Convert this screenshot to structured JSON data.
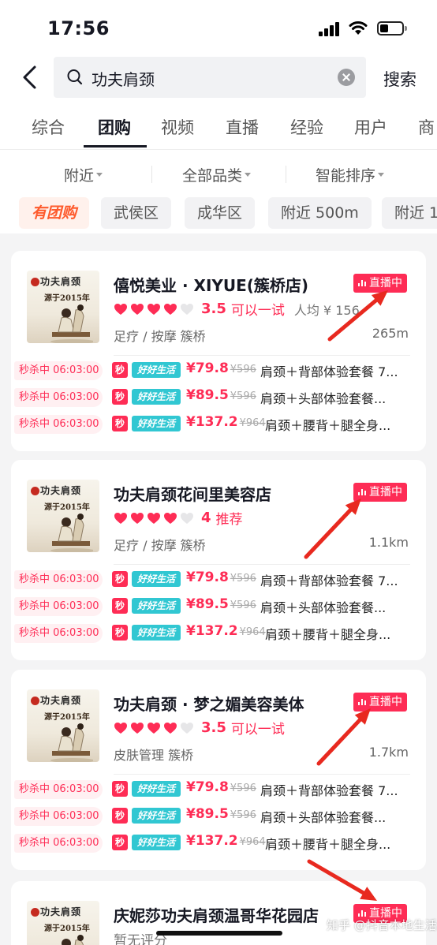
{
  "status": {
    "time": "17:56"
  },
  "search": {
    "query": "功夫肩颈",
    "button": "搜索"
  },
  "tabs": [
    "综合",
    "团购",
    "视频",
    "直播",
    "经验",
    "用户",
    "商"
  ],
  "filters": [
    "附近",
    "全部品类",
    "智能排序"
  ],
  "chips": [
    "有团购",
    "武侯区",
    "成华区",
    "附近 500m",
    "附近 1"
  ],
  "thumb": {
    "brand": "功夫肩颈",
    "since": "源于2015年"
  },
  "live_label": "直播中",
  "shops": [
    {
      "name": "僖悦美业 · XIYUE(簇桥店)",
      "hearts": 4,
      "score": "3.5",
      "verdict": "可以一试",
      "avg": "人均 ¥ 156",
      "category": "足疗 / 按摩   簇桥",
      "distance": "265m",
      "deals": [
        {
          "flash": "秒杀中 06:03:00",
          "sec": "秒",
          "tag": "好好生活",
          "price": "¥79.8",
          "orig": "¥596",
          "name": "肩颈＋背部体验套餐 7..."
        },
        {
          "flash": "秒杀中 06:03:00",
          "sec": "秒",
          "tag": "好好生活",
          "price": "¥89.5",
          "orig": "¥596",
          "name": "肩颈＋头部体验套餐..."
        },
        {
          "flash": "秒杀中 06:03:00",
          "sec": "秒",
          "tag": "好好生活",
          "price": "¥137.2",
          "orig": "¥964",
          "name": "肩颈＋腰背＋腿全身..."
        }
      ]
    },
    {
      "name": "功夫肩颈花间里美容店",
      "hearts": 4,
      "score": "4",
      "verdict": "推荐",
      "avg": "",
      "category": "足疗 / 按摩   簇桥",
      "distance": "1.1km",
      "deals": [
        {
          "flash": "秒杀中 06:03:00",
          "sec": "秒",
          "tag": "好好生活",
          "price": "¥79.8",
          "orig": "¥596",
          "name": "肩颈＋背部体验套餐 7..."
        },
        {
          "flash": "秒杀中 06:03:00",
          "sec": "秒",
          "tag": "好好生活",
          "price": "¥89.5",
          "orig": "¥596",
          "name": "肩颈＋头部体验套餐..."
        },
        {
          "flash": "秒杀中 06:03:00",
          "sec": "秒",
          "tag": "好好生活",
          "price": "¥137.2",
          "orig": "¥964",
          "name": "肩颈＋腰背＋腿全身..."
        }
      ]
    },
    {
      "name": "功夫肩颈 · 梦之媚美容美体",
      "hearts": 4,
      "score": "3.5",
      "verdict": "可以一试",
      "avg": "",
      "category": "皮肤管理   簇桥",
      "distance": "1.7km",
      "deals": [
        {
          "flash": "秒杀中 06:03:00",
          "sec": "秒",
          "tag": "好好生活",
          "price": "¥79.8",
          "orig": "¥596",
          "name": "肩颈＋背部体验套餐 7..."
        },
        {
          "flash": "秒杀中 06:03:00",
          "sec": "秒",
          "tag": "好好生活",
          "price": "¥89.5",
          "orig": "¥596",
          "name": "肩颈＋头部体验套餐..."
        },
        {
          "flash": "秒杀中 06:03:00",
          "sec": "秒",
          "tag": "好好生活",
          "price": "¥137.2",
          "orig": "¥964",
          "name": "肩颈＋腰背＋腿全身..."
        }
      ]
    },
    {
      "name": "庆妮莎功夫肩颈温哥华花园店",
      "rating_text": "暂无评分"
    }
  ],
  "watermark": "知乎 @抖音本地生活",
  "colors": {
    "accent": "#fe2c55",
    "teal": "#31c7d2",
    "orange": "#fe5a2c",
    "arrow": "#e8291f"
  }
}
